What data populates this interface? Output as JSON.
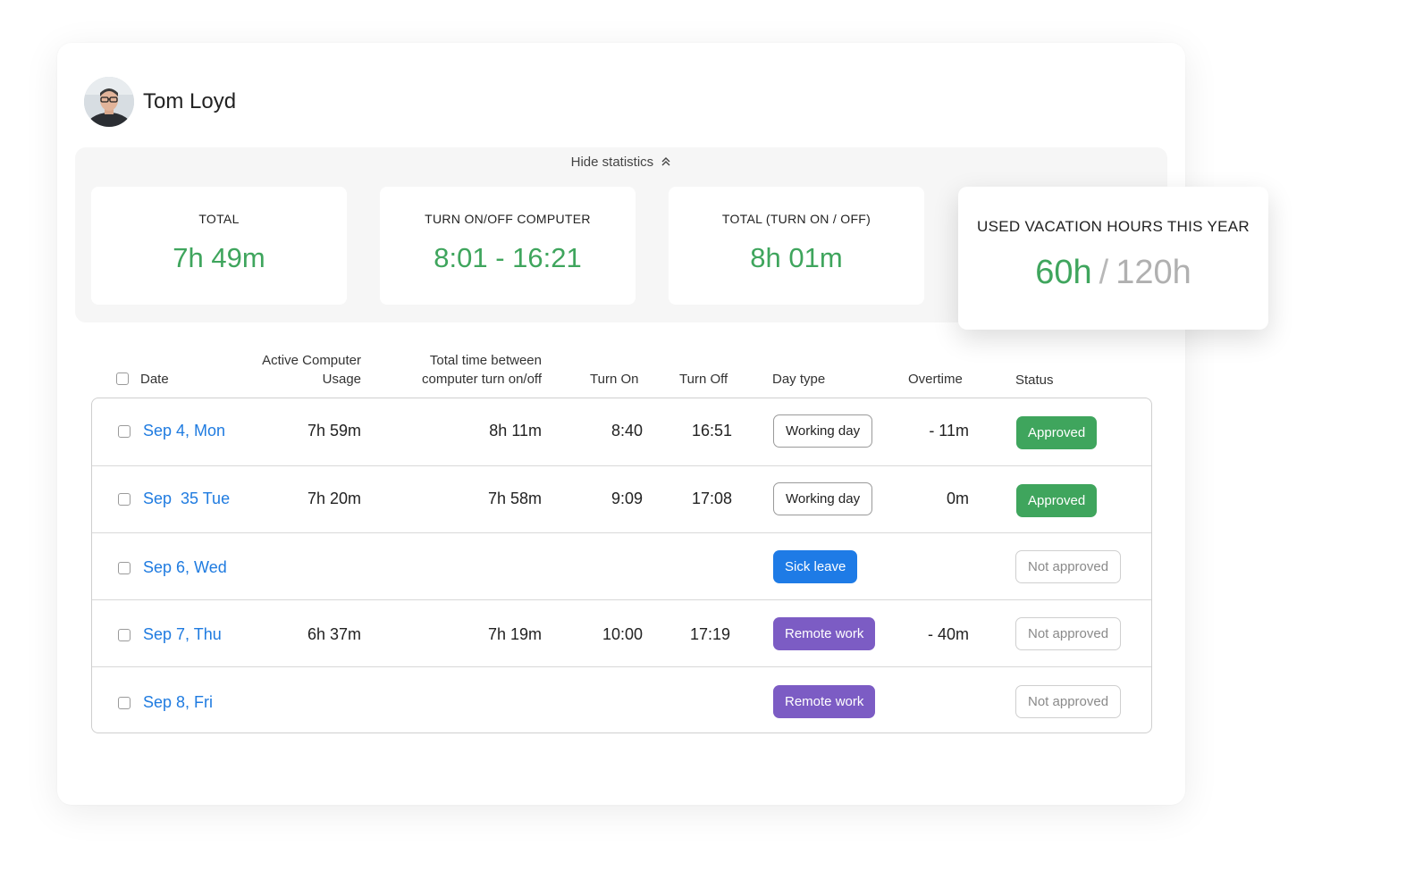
{
  "user": {
    "name": "Tom Loyd"
  },
  "stats": {
    "toggle_label": "Hide statistics",
    "cards": [
      {
        "label": "TOTAL",
        "value": "7h 49m"
      },
      {
        "label": "TURN ON/OFF COMPUTER",
        "value": "8:01 - 16:21"
      },
      {
        "label": "TOTAL (TURN ON / OFF)",
        "value": "8h 01m"
      }
    ],
    "vacation": {
      "label": "USED VACATION HOURS THIS YEAR",
      "used": "60h",
      "separator": "/",
      "total": "120h"
    }
  },
  "table": {
    "headers": {
      "date": "Date",
      "active_1": "Active Computer",
      "active_2": "Usage",
      "between_1": "Total time between",
      "between_2": "computer turn on/off",
      "turn_on": "Turn On",
      "turn_off": "Turn Off",
      "day_type": "Day type",
      "overtime": "Overtime",
      "status": "Status"
    },
    "rows": [
      {
        "date": "Sep 4, Mon",
        "active": "7h 59m",
        "between": "8h 11m",
        "on": "8:40",
        "off": "16:51",
        "day_type": "Working day",
        "overtime": "- 11m",
        "status": "Approved"
      },
      {
        "date": "Sep  35 Tue",
        "active": "7h 20m",
        "between": "7h 58m",
        "on": "9:09",
        "off": "17:08",
        "day_type": "Working day",
        "overtime": "0m",
        "status": "Approved"
      },
      {
        "date": "Sep 6, Wed",
        "active": "",
        "between": "",
        "on": "",
        "off": "",
        "day_type": "Sick leave",
        "overtime": "",
        "status": "Not approved"
      },
      {
        "date": "Sep 7, Thu",
        "active": "6h 37m",
        "between": "7h 19m",
        "on": "10:00",
        "off": "17:19",
        "day_type": "Remote work",
        "overtime": "- 40m",
        "status": "Not approved"
      },
      {
        "date": "Sep 8, Fri",
        "active": "",
        "between": "",
        "on": "",
        "off": "",
        "day_type": "Remote work",
        "overtime": "",
        "status": "Not approved"
      }
    ]
  },
  "colors": {
    "green": "#3fa55d",
    "blue": "#1e7be6",
    "purple": "#7c5cc4",
    "link": "#1f7be0"
  },
  "icons": {
    "toggle": "chevron-double-up-icon"
  }
}
